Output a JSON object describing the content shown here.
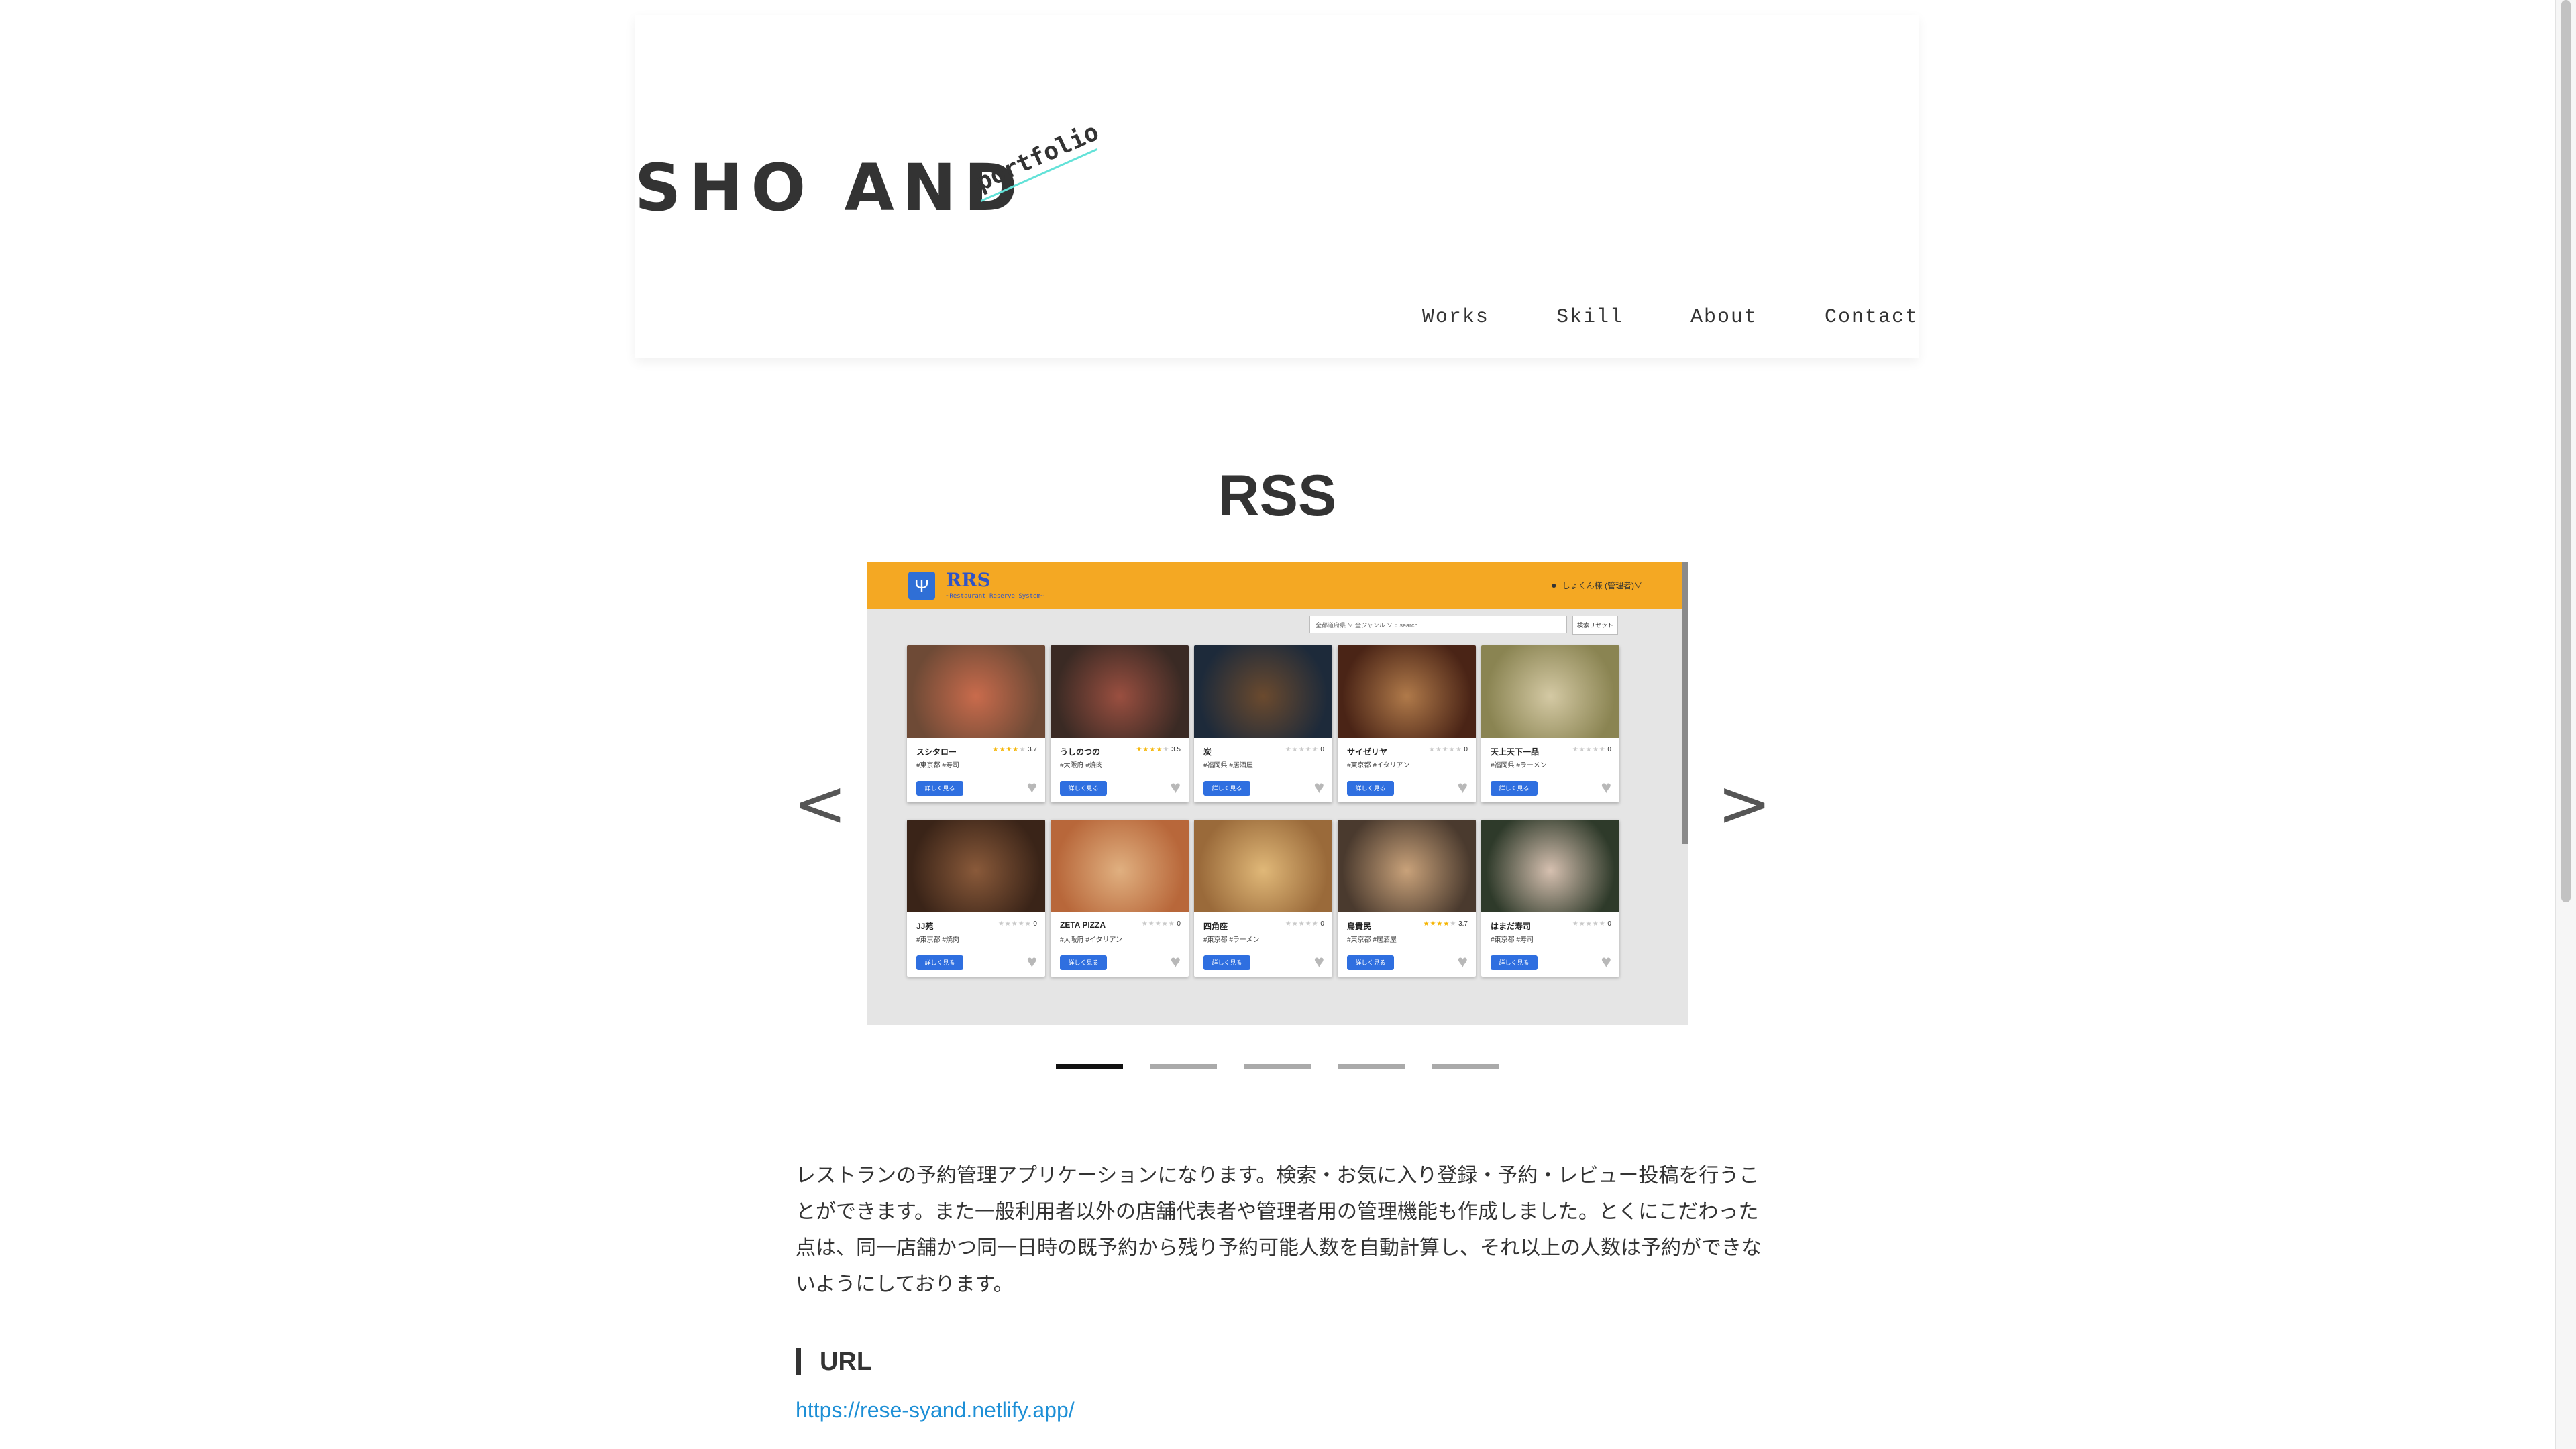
{
  "header": {
    "logo": "SHO AND",
    "logo_tag": "portfolio",
    "nav": [
      "Works",
      "Skill",
      "About",
      "Contact"
    ]
  },
  "work": {
    "title": "RSS",
    "carousel": {
      "prev": "<",
      "next": ">",
      "slide_count": 5,
      "active_slide": 1,
      "screenshot": {
        "app_name": "RRS",
        "app_sub": "~Restaurant Reserve System~",
        "user": "しょくん様 (管理者)∨",
        "search_text": "全都道府県 ∨  全ジャンル ∨  ○ search...",
        "search_button": "検索リセット",
        "detail_button": "詳しく見る",
        "cards": [
          {
            "name": "スシタロー",
            "rating": "3.7",
            "stars": 4,
            "tags": "#東京都 #寿司",
            "color1": "#6e4a36",
            "color2": "#c96b4c"
          },
          {
            "name": "うしのつの",
            "rating": "3.5",
            "stars": 4,
            "tags": "#大阪府 #焼肉",
            "color1": "#3a2a24",
            "color2": "#9a4f40"
          },
          {
            "name": "炭",
            "rating": "0",
            "stars": 0,
            "tags": "#福岡県 #居酒屋",
            "color1": "#1d2a3a",
            "color2": "#6b4a2e"
          },
          {
            "name": "サイゼリヤ",
            "rating": "0",
            "stars": 0,
            "tags": "#東京都 #イタリアン",
            "color1": "#4a2416",
            "color2": "#b07a4a"
          },
          {
            "name": "天上天下一品",
            "rating": "0",
            "stars": 0,
            "tags": "#福岡県 #ラーメン",
            "color1": "#8a8452",
            "color2": "#d4c9a4"
          },
          {
            "name": "JJ苑",
            "rating": "0",
            "stars": 0,
            "tags": "#東京都 #焼肉",
            "color1": "#3a2418",
            "color2": "#8a5a3a"
          },
          {
            "name": "ZETA PIZZA",
            "rating": "0",
            "stars": 0,
            "tags": "#大阪府 #イタリアン",
            "color1": "#b8673a",
            "color2": "#e0b080"
          },
          {
            "name": "四角座",
            "rating": "0",
            "stars": 0,
            "tags": "#東京都 #ラーメン",
            "color1": "#9a6a3a",
            "color2": "#e0b878"
          },
          {
            "name": "鳥貴民",
            "rating": "3.7",
            "stars": 4,
            "tags": "#東京都 #居酒屋",
            "color1": "#4a3a2e",
            "color2": "#c9a27a"
          },
          {
            "name": "はまだ寿司",
            "rating": "0",
            "stars": 0,
            "tags": "#東京都 #寿司",
            "color1": "#2e3a2a",
            "color2": "#d6c0b0"
          }
        ]
      }
    },
    "description": "レストランの予約管理アプリケーションになります。検索・お気に入り登録・予約・レビュー投稿を行うことができます。また一般利用者以外の店舗代表者や管理者用の管理機能も作成しました。とくにこだわった点は、同一店舗かつ同一日時の既予約から残り予約可能人数を自動計算し、それ以上の人数は予約ができないようにしております。",
    "url_heading": "URL",
    "url": "https://rese-syand.netlify.app/"
  }
}
